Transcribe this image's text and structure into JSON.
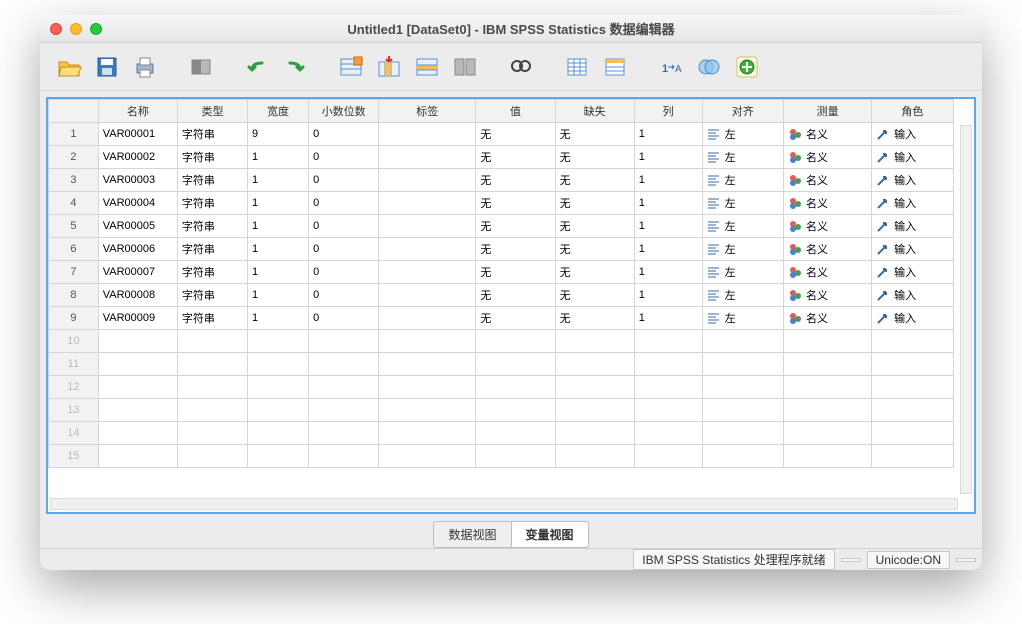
{
  "title": "Untitled1 [DataSet0] - IBM SPSS Statistics 数据编辑器",
  "columns": [
    "名称",
    "类型",
    "宽度",
    "小数位数",
    "标签",
    "值",
    "缺失",
    "列",
    "对齐",
    "测量",
    "角色"
  ],
  "rows": [
    {
      "n": 1,
      "name": "VAR00001",
      "type": "字符串",
      "width": "9",
      "dec": "0",
      "label": "",
      "values": "无",
      "missing": "无",
      "cols": "1",
      "align": "左",
      "measure": "名义",
      "role": "输入"
    },
    {
      "n": 2,
      "name": "VAR00002",
      "type": "字符串",
      "width": "1",
      "dec": "0",
      "label": "",
      "values": "无",
      "missing": "无",
      "cols": "1",
      "align": "左",
      "measure": "名义",
      "role": "输入"
    },
    {
      "n": 3,
      "name": "VAR00003",
      "type": "字符串",
      "width": "1",
      "dec": "0",
      "label": "",
      "values": "无",
      "missing": "无",
      "cols": "1",
      "align": "左",
      "measure": "名义",
      "role": "输入"
    },
    {
      "n": 4,
      "name": "VAR00004",
      "type": "字符串",
      "width": "1",
      "dec": "0",
      "label": "",
      "values": "无",
      "missing": "无",
      "cols": "1",
      "align": "左",
      "measure": "名义",
      "role": "输入"
    },
    {
      "n": 5,
      "name": "VAR00005",
      "type": "字符串",
      "width": "1",
      "dec": "0",
      "label": "",
      "values": "无",
      "missing": "无",
      "cols": "1",
      "align": "左",
      "measure": "名义",
      "role": "输入"
    },
    {
      "n": 6,
      "name": "VAR00006",
      "type": "字符串",
      "width": "1",
      "dec": "0",
      "label": "",
      "values": "无",
      "missing": "无",
      "cols": "1",
      "align": "左",
      "measure": "名义",
      "role": "输入"
    },
    {
      "n": 7,
      "name": "VAR00007",
      "type": "字符串",
      "width": "1",
      "dec": "0",
      "label": "",
      "values": "无",
      "missing": "无",
      "cols": "1",
      "align": "左",
      "measure": "名义",
      "role": "输入"
    },
    {
      "n": 8,
      "name": "VAR00008",
      "type": "字符串",
      "width": "1",
      "dec": "0",
      "label": "",
      "values": "无",
      "missing": "无",
      "cols": "1",
      "align": "左",
      "measure": "名义",
      "role": "输入"
    },
    {
      "n": 9,
      "name": "VAR00009",
      "type": "字符串",
      "width": "1",
      "dec": "0",
      "label": "",
      "values": "无",
      "missing": "无",
      "cols": "1",
      "align": "左",
      "measure": "名义",
      "role": "输入"
    }
  ],
  "empty_rows": [
    10,
    11,
    12,
    13,
    14,
    15
  ],
  "tabs": {
    "data": "数据视图",
    "variable": "变量视图"
  },
  "status": {
    "ready": "IBM SPSS Statistics 处理程序就绪",
    "unicode": "Unicode:ON"
  },
  "toolbar_icons": [
    "open",
    "save",
    "print",
    "goto-case",
    "undo",
    "redo",
    "dialog-recall",
    "insert-variable",
    "insert-case",
    "split-file",
    "find",
    "weight-case",
    "select-cases",
    "value-labels",
    "use-sets",
    "run"
  ]
}
